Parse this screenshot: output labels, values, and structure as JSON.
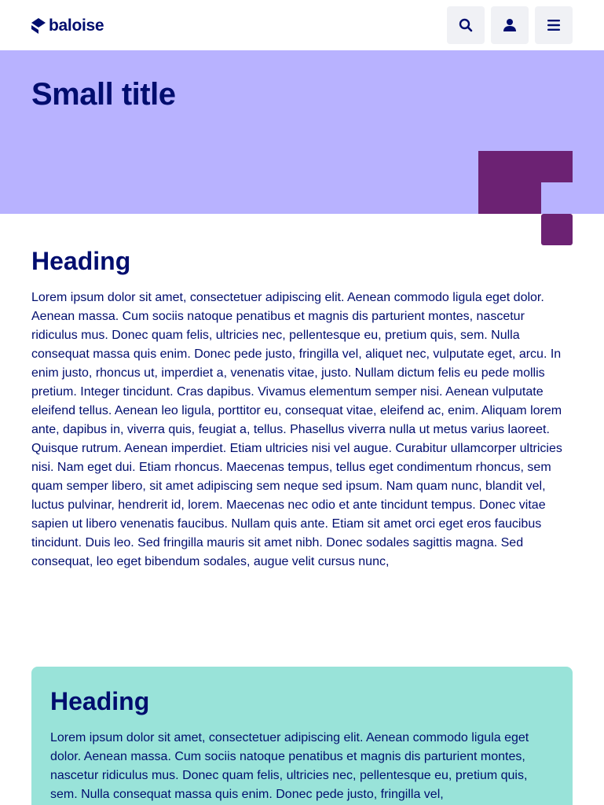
{
  "header": {
    "logo_text": "baloise",
    "search_icon": "search-icon",
    "user_icon": "user-icon",
    "menu_icon": "hamburger-menu-icon"
  },
  "hero": {
    "title": "Small title"
  },
  "main": {
    "heading": "Heading",
    "text": "Lorem ipsum dolor sit amet, consectetuer adipiscing elit. Aenean commodo ligula eget dolor. Aenean massa. Cum sociis natoque penatibus et magnis dis parturient montes, nascetur ridiculus mus. Donec quam felis, ultricies nec, pellentesque eu, pretium quis, sem. Nulla consequat massa quis enim. Donec pede justo, fringilla vel, aliquet nec, vulputate eget, arcu. In enim justo, rhoncus ut, imperdiet a, venenatis vitae, justo. Nullam dictum felis eu pede mollis pretium. Integer tincidunt. Cras dapibus. Vivamus elementum semper nisi. Aenean vulputate eleifend tellus. Aenean leo ligula, porttitor eu, consequat vitae, eleifend ac, enim. Aliquam lorem ante, dapibus in, viverra quis, feugiat a, tellus. Phasellus viverra nulla ut metus varius laoreet. Quisque rutrum. Aenean imperdiet. Etiam ultricies nisi vel augue. Curabitur ullamcorper ultricies nisi. Nam eget dui. Etiam rhoncus. Maecenas tempus, tellus eget condimentum rhoncus, sem quam semper libero, sit amet adipiscing sem neque sed ipsum. Nam quam nunc, blandit vel, luctus pulvinar, hendrerit id, lorem. Maecenas nec odio et ante tincidunt tempus. Donec vitae sapien ut libero venenatis faucibus. Nullam quis ante. Etiam sit amet orci eget eros faucibus tincidunt. Duis leo. Sed fringilla mauris sit amet nibh. Donec sodales sagittis magna. Sed consequat, leo eget bibendum sodales, augue velit cursus nunc,"
  },
  "card": {
    "heading": "Heading",
    "text": "Lorem ipsum dolor sit amet, consectetuer adipiscing elit. Aenean commodo ligula eget dolor. Aenean massa. Cum sociis natoque penatibus et magnis dis parturient montes, nascetur ridiculus mus. Donec quam felis, ultricies nec, pellentesque eu, pretium quis, sem. Nulla consequat massa quis enim. Donec pede justo, fringilla vel,"
  },
  "colors": {
    "brand_primary": "#000d6e",
    "hero_background": "#b8b2ff",
    "hero_shape": "#6c2273",
    "card_background": "#99e3d9",
    "button_background": "#f0f1f5"
  }
}
